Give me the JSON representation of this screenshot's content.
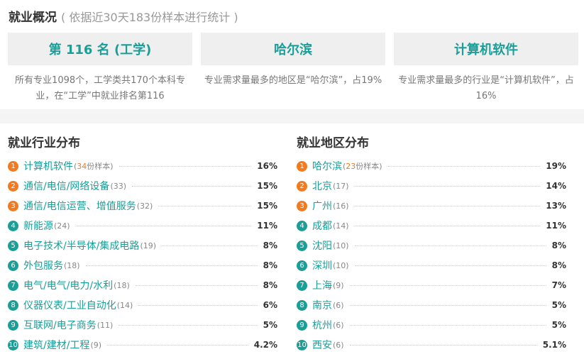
{
  "header": {
    "title": "就业概况",
    "subtitle": "( 依据近30天183份样本进行统计 )"
  },
  "summary": [
    {
      "headline": "第 116 名 (工学)",
      "desc": "所有专业1098个，工学类共170个本科专业，在“工学”中就业排名第116"
    },
    {
      "headline": "哈尔滨",
      "desc": "专业需求量最多的地区是“哈尔滨”，占19%"
    },
    {
      "headline": "计算机软件",
      "desc": "专业需求量最多的行业是“计算机软件”，占16%"
    }
  ],
  "industry": {
    "title": "就业行业分布",
    "items": [
      {
        "rank": "1",
        "name": "计算机软件",
        "count": "34",
        "count_suffix": "份样本",
        "pct": "16%"
      },
      {
        "rank": "2",
        "name": "通信/电信/网络设备",
        "count": "33",
        "pct": "15%"
      },
      {
        "rank": "3",
        "name": "通信/电信运营、增值服务",
        "count": "32",
        "pct": "15%"
      },
      {
        "rank": "4",
        "name": "新能源",
        "count": "24",
        "pct": "11%"
      },
      {
        "rank": "5",
        "name": "电子技术/半导体/集成电路",
        "count": "19",
        "pct": "8%"
      },
      {
        "rank": "6",
        "name": "外包服务",
        "count": "18",
        "pct": "8%"
      },
      {
        "rank": "7",
        "name": "电气/电气/电力/水利",
        "count": "18",
        "pct": "8%"
      },
      {
        "rank": "8",
        "name": "仪器仪表/工业自动化",
        "count": "14",
        "pct": "6%"
      },
      {
        "rank": "9",
        "name": "互联网/电子商务",
        "count": "11",
        "pct": "5%"
      },
      {
        "rank": "10",
        "name": "建筑/建材/工程",
        "count": "9",
        "pct": "4.2%"
      }
    ]
  },
  "region": {
    "title": "就业地区分布",
    "items": [
      {
        "rank": "1",
        "name": "哈尔滨",
        "count": "23",
        "count_suffix": "份样本",
        "pct": "19%"
      },
      {
        "rank": "2",
        "name": "北京",
        "count": "17",
        "pct": "14%"
      },
      {
        "rank": "3",
        "name": "广州",
        "count": "16",
        "pct": "13%"
      },
      {
        "rank": "4",
        "name": "成都",
        "count": "14",
        "pct": "11%"
      },
      {
        "rank": "5",
        "name": "沈阳",
        "count": "10",
        "pct": "8%"
      },
      {
        "rank": "6",
        "name": "深圳",
        "count": "10",
        "pct": "8%"
      },
      {
        "rank": "7",
        "name": "上海",
        "count": "9",
        "pct": "7%"
      },
      {
        "rank": "8",
        "name": "南京",
        "count": "6",
        "pct": "5%"
      },
      {
        "rank": "9",
        "name": "杭州",
        "count": "6",
        "pct": "5%"
      },
      {
        "rank": "10",
        "name": "西安",
        "count": "6",
        "pct": "5.1%"
      }
    ]
  },
  "colors": {
    "accent": "#1a9e98",
    "top_rank": "#f37a1f",
    "card_bg": "#efefef"
  }
}
